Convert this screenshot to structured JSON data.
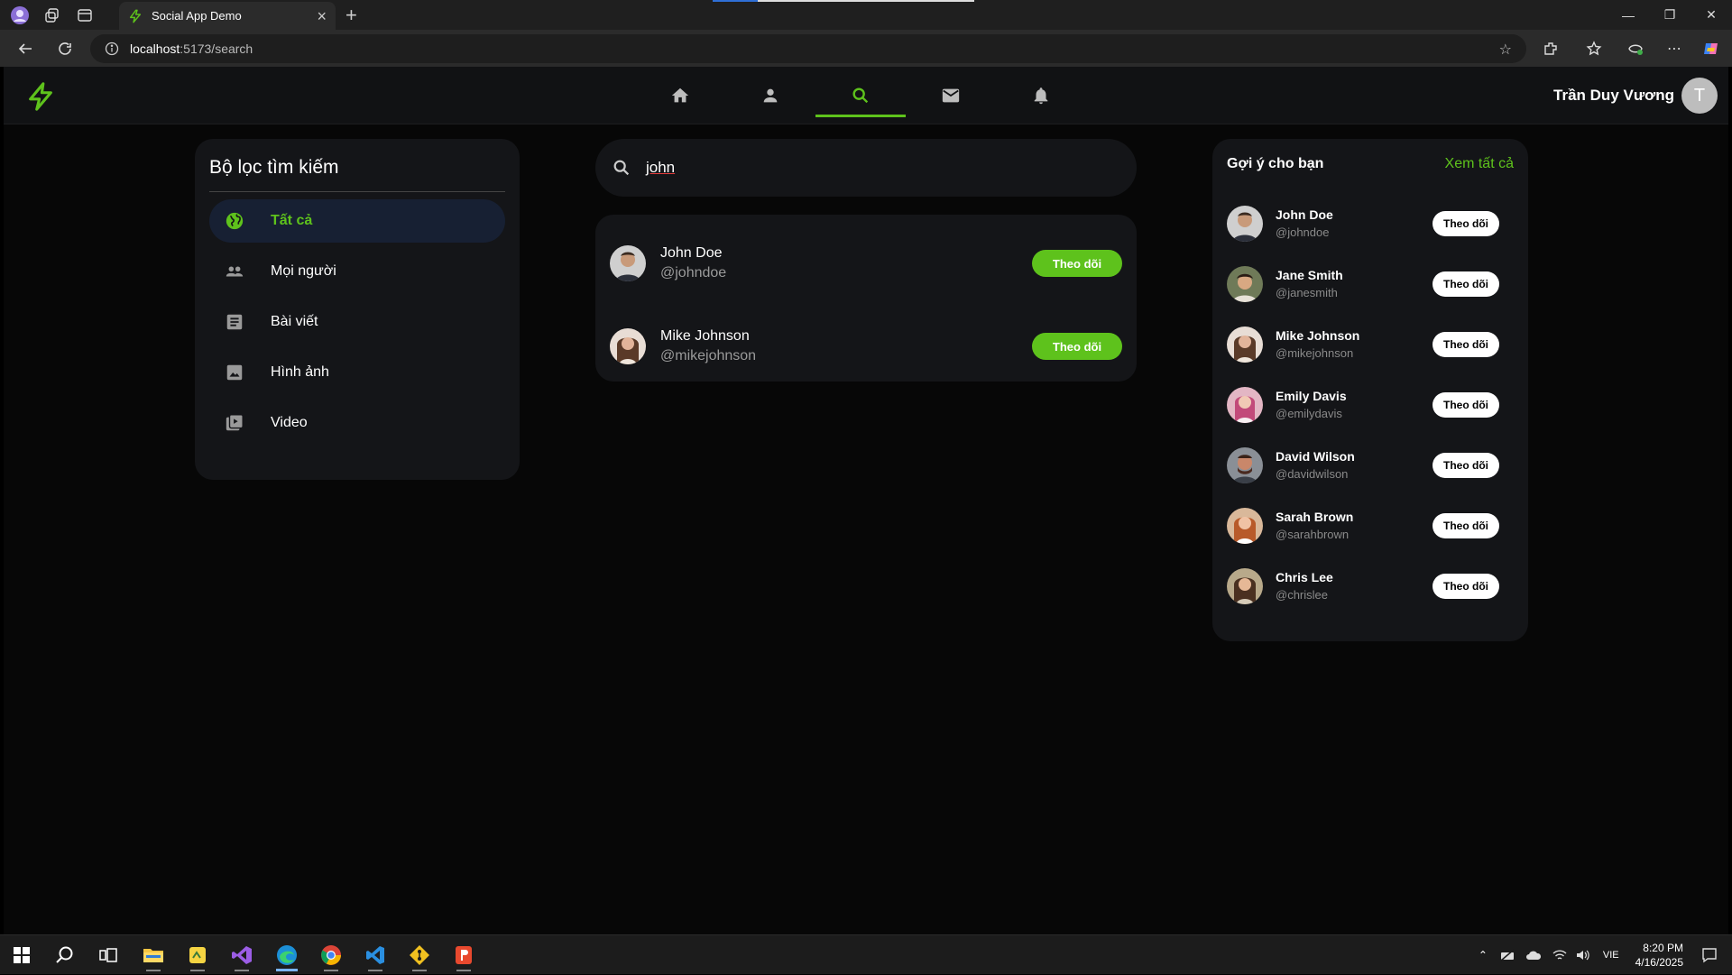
{
  "browser": {
    "tab_title": "Social App Demo",
    "url_host": "localhost",
    "url_rest": ":5173/search"
  },
  "app": {
    "user_name": "Trần Duy Vương",
    "user_initial": "T",
    "nav_items": [
      "home-icon",
      "person-icon",
      "search-icon",
      "mail-icon",
      "bell-icon"
    ],
    "active_nav": "search-icon",
    "accent": "#5ec21c"
  },
  "filters": {
    "title": "Bộ lọc tìm kiếm",
    "items": [
      {
        "label": "Tất cả",
        "icon": "globe-icon",
        "active": true
      },
      {
        "label": "Mọi người",
        "icon": "people-icon"
      },
      {
        "label": "Bài viết",
        "icon": "article-icon"
      },
      {
        "label": "Hình ảnh",
        "icon": "image-icon"
      },
      {
        "label": "Video",
        "icon": "video-library-icon"
      }
    ]
  },
  "search": {
    "query": "john",
    "results": [
      {
        "name": "John Doe",
        "handle": "@johndoe",
        "button": "Theo dõi"
      },
      {
        "name": "Mike Johnson",
        "handle": "@mikejohnson",
        "button": "Theo dõi"
      }
    ]
  },
  "suggestions": {
    "title": "Gợi ý cho bạn",
    "see_all": "Xem tất cả",
    "items": [
      {
        "name": "John Doe",
        "handle": "@johndoe",
        "button": "Theo dõi"
      },
      {
        "name": "Jane Smith",
        "handle": "@janesmith",
        "button": "Theo dõi"
      },
      {
        "name": "Mike Johnson",
        "handle": "@mikejohnson",
        "button": "Theo dõi"
      },
      {
        "name": "Emily Davis",
        "handle": "@emilydavis",
        "button": "Theo dõi"
      },
      {
        "name": "David Wilson",
        "handle": "@davidwilson",
        "button": "Theo dõi"
      },
      {
        "name": "Sarah Brown",
        "handle": "@sarahbrown",
        "button": "Theo dõi"
      },
      {
        "name": "Chris Lee",
        "handle": "@chrislee",
        "button": "Theo dõi"
      }
    ]
  },
  "taskbar": {
    "lang": "VIE",
    "time": "8:20 PM",
    "date": "4/16/2025"
  }
}
